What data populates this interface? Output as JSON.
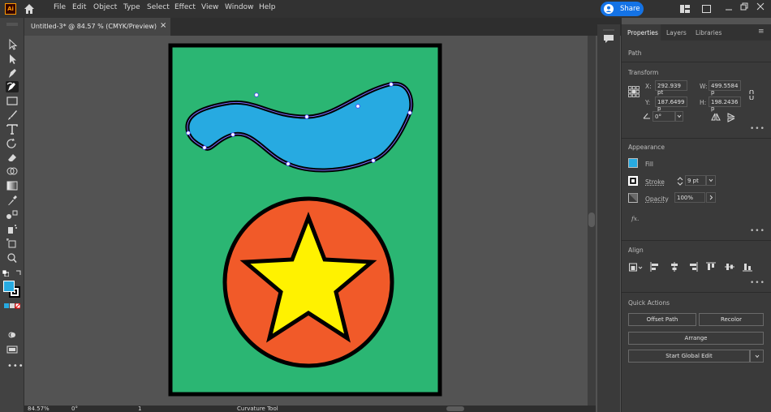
{
  "app": {
    "logo": "Ai"
  },
  "menu": [
    "File",
    "Edit",
    "Object",
    "Type",
    "Select",
    "Effect",
    "View",
    "Window",
    "Help"
  ],
  "share_label": "Share",
  "document_tab": {
    "title": "Untitled-3* @ 84.57 % (CMYK/Preview)",
    "close": "×"
  },
  "panel": {
    "tabs": [
      "Properties",
      "Layers",
      "Libraries"
    ],
    "selection_type": "Path",
    "transform": {
      "heading": "Transform",
      "x_label": "X:",
      "x": "292.939 pt",
      "y_label": "Y:",
      "y": "187.6499 p",
      "w_label": "W:",
      "w": "499.5584 p",
      "h_label": "H:",
      "h": "198.2436 p",
      "angle": "0°"
    },
    "appearance": {
      "heading": "Appearance",
      "fill_label": "Fill",
      "stroke_label": "Stroke",
      "stroke_weight": "9 pt",
      "opacity_label": "Opacity",
      "opacity": "100%",
      "fx_label": "fx."
    },
    "align": {
      "heading": "Align"
    },
    "quick_actions": {
      "heading": "Quick Actions",
      "offset_path": "Offset Path",
      "recolor": "Recolor",
      "arrange": "Arrange",
      "global_edit": "Start Global Edit"
    }
  },
  "status": {
    "zoom": "84.57%",
    "rotation": "0°",
    "artboard": "1",
    "tool": "Curvature Tool"
  },
  "colors": {
    "artboard_green": "#2bb673",
    "blob_blue": "#27aae1",
    "circle_orange": "#f15a29",
    "star_yellow": "#fff200",
    "stroke_black": "#000000",
    "accent_blue": "#1473e6"
  }
}
